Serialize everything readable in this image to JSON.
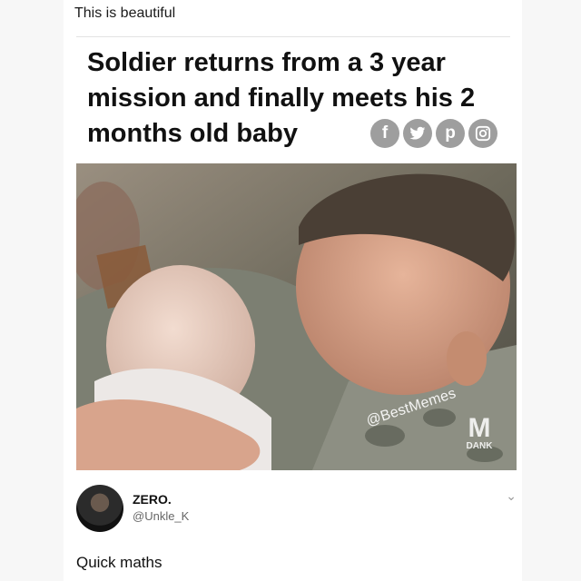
{
  "post": {
    "caption": "This is beautiful",
    "headline": "Soldier returns from a 3 year mission and finally meets his 2 months old baby",
    "share_icons": [
      {
        "name": "facebook-icon",
        "glyph": "f"
      },
      {
        "name": "twitter-icon",
        "glyph": "t"
      },
      {
        "name": "pinterest-icon",
        "glyph": "p"
      },
      {
        "name": "instagram-icon",
        "glyph": "◎"
      }
    ],
    "image": {
      "watermark": "@BestMemes",
      "logo_text": "DANK",
      "logo_mark": "M"
    }
  },
  "reply": {
    "name": "ZERO.",
    "handle": "@Unkle_K",
    "text": "Quick maths",
    "menu_icon": "chevron-down-icon"
  },
  "colors": {
    "background": "#f7f7f7",
    "card": "#ffffff",
    "text": "#111111",
    "secondary_text": "#666666",
    "social_icon": "#9e9e9e"
  }
}
